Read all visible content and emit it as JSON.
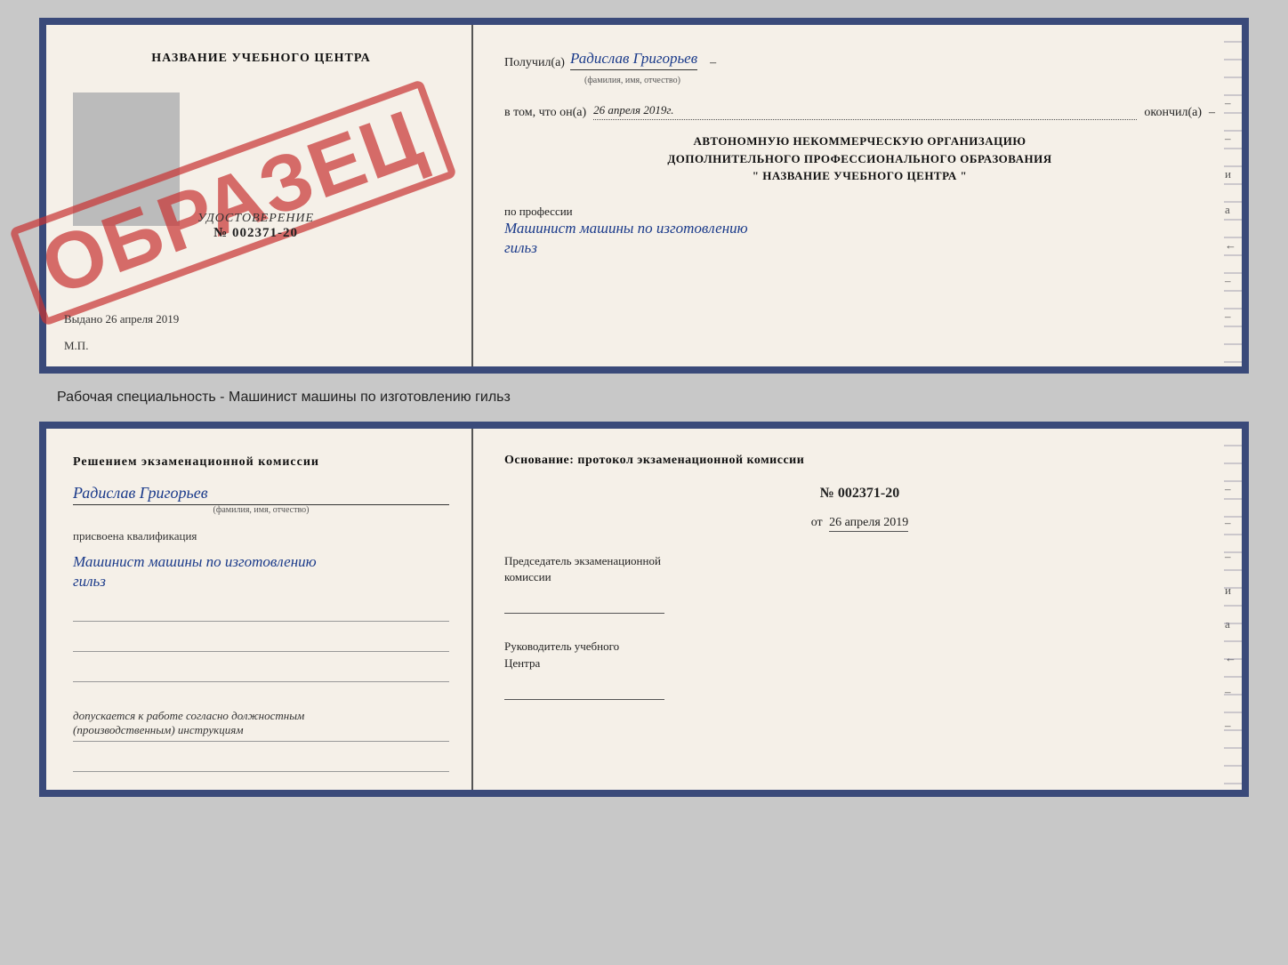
{
  "topDoc": {
    "left": {
      "orgTitle": "НАЗВАНИЕ УЧЕБНОГО ЦЕНТРА",
      "stamp": "ОБРАЗЕЦ",
      "udostoverenie": "УДОСТОВЕРЕНИЕ",
      "number": "№ 002371-20",
      "vydano": "Выдано 26 апреля 2019",
      "mp": "М.П."
    },
    "right": {
      "poluchilPrefix": "Получил(а)",
      "personName": "Радислав Григорьев",
      "fioSubtext": "(фамилия, имя, отчество)",
      "dash1": "–",
      "vtomChto": "в том, что он(а)",
      "date": "26 апреля 2019г.",
      "okonchil": "окончил(а)",
      "dash2": "–",
      "orgLine1": "АВТОНОМНУЮ НЕКОММЕРЧЕСКУЮ ОРГАНИЗАЦИЮ",
      "orgLine2": "ДОПОЛНИТЕЛЬНОГО ПРОФЕССИОНАЛЬНОГО ОБРАЗОВАНИЯ",
      "orgLine3": "\"  НАЗВАНИЕ УЧЕБНОГО ЦЕНТРА  \"",
      "dash3": "–",
      "i": "и",
      "a": "а",
      "leftArrow": "←",
      "poProfessii": "по профессии",
      "professionName": "Машинист машины по изготовлению",
      "professionName2": "гильз"
    }
  },
  "caption": "Рабочая специальность - Машинист машины по изготовлению гильз",
  "bottomDoc": {
    "left": {
      "resheniemTitle": "Решением  экзаменационной  комиссии",
      "personName": "Радислав Григорьев",
      "fioSubtext": "(фамилия, имя, отчество)",
      "prisvoena": "присвоена квалификация",
      "qualificationName": "Машинист машины по изготовлению",
      "qualificationName2": "гильз",
      "dopuskaetsya": "допускается к  работе согласно должностным",
      "dopuskaetsya2": "(производственным) инструкциям"
    },
    "right": {
      "osnovanie": "Основание: протокол экзаменационной  комиссии",
      "number": "№  002371-20",
      "ot": "от",
      "date": "26 апреля 2019",
      "predsedatelLabel1": "Председатель экзаменационной",
      "predsedatelLabel2": "комиссии",
      "rukovoditelLabel1": "Руководитель учебного",
      "rukovoditelLabel2": "Центра",
      "i": "и",
      "a": "а",
      "leftArrow": "←"
    }
  }
}
